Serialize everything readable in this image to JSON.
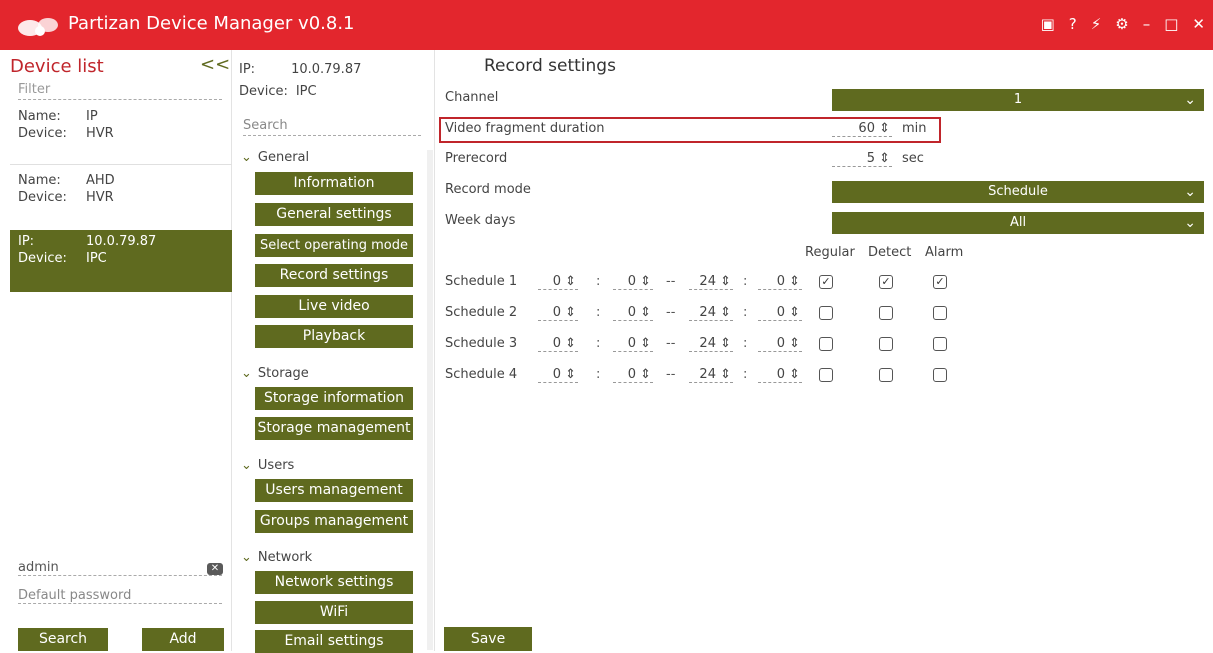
{
  "app": {
    "title": "Partizan Device Manager v0.8.1"
  },
  "device_list": {
    "header": "Device list",
    "collapse_label": "<<",
    "filter_placeholder": "Filter",
    "devices": [
      {
        "k1": "Name:",
        "v1": "IP",
        "k2": "Device:",
        "v2": "HVR"
      },
      {
        "k1": "Name:",
        "v1": "AHD",
        "k2": "Device:",
        "v2": "HVR"
      },
      {
        "k1": "IP:",
        "v1": "10.0.79.87",
        "k2": "Device:",
        "v2": "IPC"
      }
    ],
    "username": "admin",
    "password_placeholder": "Default password",
    "search_label": "Search",
    "add_label": "Add"
  },
  "nav": {
    "ip_label": "IP:",
    "ip_value": "10.0.79.87",
    "device_label": "Device:",
    "device_value": "IPC",
    "search_placeholder": "Search",
    "sections": [
      {
        "label": "General",
        "items": [
          "Information",
          "General settings",
          "Select operating mode",
          "Record settings",
          "Live video",
          "Playback"
        ]
      },
      {
        "label": "Storage",
        "items": [
          "Storage information",
          "Storage management"
        ]
      },
      {
        "label": "Users",
        "items": [
          "Users management",
          "Groups management"
        ]
      },
      {
        "label": "Network",
        "items": [
          "Network settings",
          "WiFi",
          "Email settings"
        ]
      }
    ]
  },
  "record": {
    "heading": "Record settings",
    "channel_label": "Channel",
    "channel_value": "1",
    "fragment_label": "Video fragment duration",
    "fragment_value": "60",
    "fragment_unit": "min",
    "prerecord_label": "Prerecord",
    "prerecord_value": "5",
    "prerecord_unit": "sec",
    "mode_label": "Record mode",
    "mode_value": "Schedule",
    "weekdays_label": "Week days",
    "weekdays_value": "All",
    "col_regular": "Regular",
    "col_detect": "Detect",
    "col_alarm": "Alarm",
    "schedules": [
      {
        "label": "Schedule 1",
        "h1": "0",
        "m1": "0",
        "h2": "24",
        "m2": "0",
        "regular": true,
        "detect": true,
        "alarm": true
      },
      {
        "label": "Schedule 2",
        "h1": "0",
        "m1": "0",
        "h2": "24",
        "m2": "0",
        "regular": false,
        "detect": false,
        "alarm": false
      },
      {
        "label": "Schedule 3",
        "h1": "0",
        "m1": "0",
        "h2": "24",
        "m2": "0",
        "regular": false,
        "detect": false,
        "alarm": false
      },
      {
        "label": "Schedule 4",
        "h1": "0",
        "m1": "0",
        "h2": "24",
        "m2": "0",
        "regular": false,
        "detect": false,
        "alarm": false
      }
    ],
    "save_label": "Save"
  },
  "colors": {
    "titlebar": "#e3262d",
    "accent": "#5f6a1f",
    "highlight": "#c0252b"
  }
}
